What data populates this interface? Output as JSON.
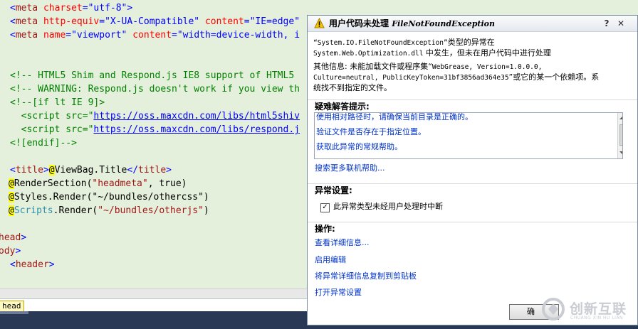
{
  "editor": {
    "lines": {
      "l1_tag": "meta",
      "l1_attr1": "charset",
      "l1_val1": "\"utf-8\"",
      "l2_tag": "meta",
      "l2_attr1": "http-equiv",
      "l2_val1": "\"X-UA-Compatible\"",
      "l2_attr2": "content",
      "l2_val2": "\"IE=edge\"",
      "l3_tag": "meta",
      "l3_attr1": "name",
      "l3_val1": "\"viewport\"",
      "l3_attr2": "content",
      "l3_val2": "\"width=device-width, i",
      "l5_comment": "<!-- HTML5 Shim and Respond.js IE8 support of HTML5",
      "l6_comment": "<!-- WARNING: Respond.js doesn't work if you view th",
      "l7_comment": "<!--[if lt IE 9]>",
      "l8_src": "src",
      "l8_url": "https://oss.maxcdn.com/libs/html5shiv",
      "l9_src": "src",
      "l9_url": "https://oss.maxcdn.com/libs/respond.j",
      "l10_comment": "<![endif]-->",
      "l12_tag": "title",
      "l12_code": "ViewBag.Title",
      "l12_close": "title",
      "l13_code": "RenderSection(",
      "l13_str": "\"headmeta\"",
      "l13_rest": ", true)",
      "l14_code": "Styles.Render(\"~/bundles/othercss\")",
      "l15_code1": "Scripts",
      "l15_code2": ".Render(",
      "l15_str": "\"~/bundles/otherjs\"",
      "l15_rest": ")",
      "l17_tag": "head",
      "l18_tag": "ody",
      "l19_tag": "header"
    },
    "nav_crumb": "head"
  },
  "dialog": {
    "title_cn": "用户代码未处理",
    "title_exc": "FileNotFoundException",
    "help_label": "?",
    "close_label": "✕",
    "message": {
      "p1": "“System.IO.FileNotFoundException”",
      "p2": "类型的异常在",
      "p3": "System.Web.Optimization.dll",
      "p4": " 中发生，但未在用户代码中进行处理"
    },
    "detail": {
      "label": "其他信息: 未能加载文件或程序集“",
      "asm": "WebGrease, Version=1.0.0.0,",
      "asm2": "Culture=neutral, PublicKeyToken=31bf3856ad364e35",
      "rest": "”或它的某一个依赖项。系",
      "rest2": "统找不到指定的文件。"
    },
    "tips_heading": "疑难解答提示:",
    "tips": [
      "使用相对路径时，请确保当前目录是正确的。",
      "验证文件是否存在于指定位置。",
      "获取此异常的常规帮助。"
    ],
    "more_help": "搜索更多联机帮助...",
    "exception_settings_heading": "异常设置:",
    "break_checkbox_label": "此异常类型未经用户处理时中断",
    "break_checked": true,
    "actions_heading": "操作:",
    "actions": [
      "查看详细信息...",
      "启用编辑",
      "将异常详细信息复制到剪贴板",
      "打开异常设置"
    ],
    "ok_label": "确"
  },
  "watermark": {
    "text": "创新互联",
    "sub": "CHUANG XIN HU LIAN"
  }
}
